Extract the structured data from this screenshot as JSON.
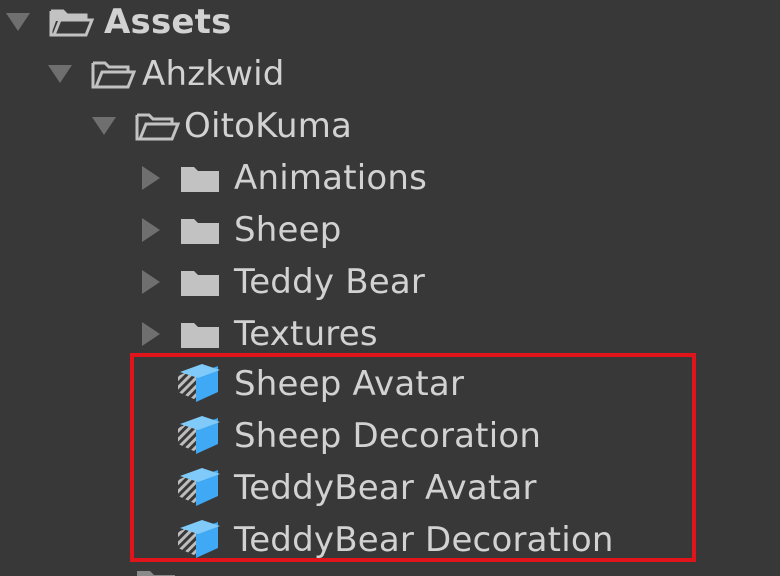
{
  "tree": {
    "root": {
      "label": "Assets",
      "expanded": true
    },
    "items": [
      {
        "label": "Ahzkwid",
        "type": "folder-open",
        "expanded": true
      },
      {
        "label": "OitoKuma",
        "type": "folder-open",
        "expanded": true
      },
      {
        "label": "Animations",
        "type": "folder",
        "expanded": false
      },
      {
        "label": "Sheep",
        "type": "folder",
        "expanded": false
      },
      {
        "label": "Teddy Bear",
        "type": "folder",
        "expanded": false
      },
      {
        "label": "Textures",
        "type": "folder",
        "expanded": false
      },
      {
        "label": "Sheep Avatar",
        "type": "prefab"
      },
      {
        "label": "Sheep Decoration",
        "type": "prefab"
      },
      {
        "label": "TeddyBear Avatar",
        "type": "prefab"
      },
      {
        "label": "TeddyBear Decoration",
        "type": "prefab"
      }
    ]
  },
  "colors": {
    "background": "#383838",
    "text": "#d2d2d2",
    "folder_icon": "#c2c2c2",
    "prefab_icon": "#3fa9f5",
    "arrow": "#6f6f6f",
    "highlight_border": "#e0141b"
  }
}
